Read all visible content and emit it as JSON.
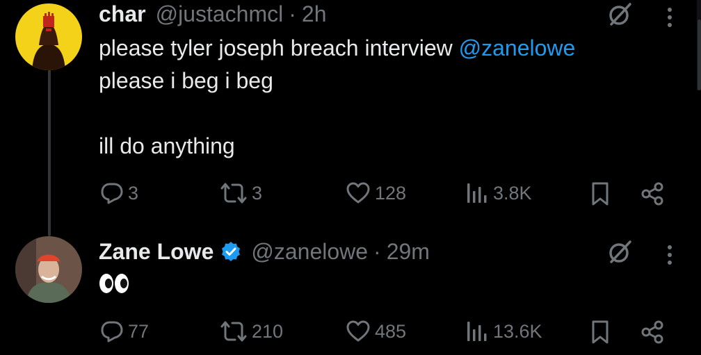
{
  "tweets": [
    {
      "name": "char",
      "handle": "@justachmcl",
      "separator": "·",
      "time": "2h",
      "text_before_mention": "please tyler joseph breach interview ",
      "mention": "@zanelowe",
      "text_after": "please i beg i beg\n\nill do anything",
      "stats": {
        "replies": "3",
        "reposts": "3",
        "likes": "128",
        "views": "3.8K"
      },
      "verified": false
    },
    {
      "name": "Zane Lowe",
      "handle": "@zanelowe",
      "separator": "·",
      "time": "29m",
      "text": "👀",
      "stats": {
        "replies": "77",
        "reposts": "210",
        "likes": "485",
        "views": "13.6K"
      },
      "verified": true
    }
  ],
  "icons": {
    "reply": "comment-icon",
    "repost": "repost-icon",
    "like": "heart-icon",
    "views": "analytics-icon",
    "bookmark": "bookmark-icon",
    "share": "share-icon",
    "grok": "grok-icon",
    "more": "more-vertical-icon",
    "verified": "verified-badge-icon"
  },
  "colors": {
    "background": "#000000",
    "text": "#e7e9ea",
    "secondary": "#71767b",
    "mention": "#1d9bf0",
    "verified": "#1d9bf0",
    "avatar1_bg": "#f5d21a",
    "avatar2_bg": "#6b5347"
  }
}
